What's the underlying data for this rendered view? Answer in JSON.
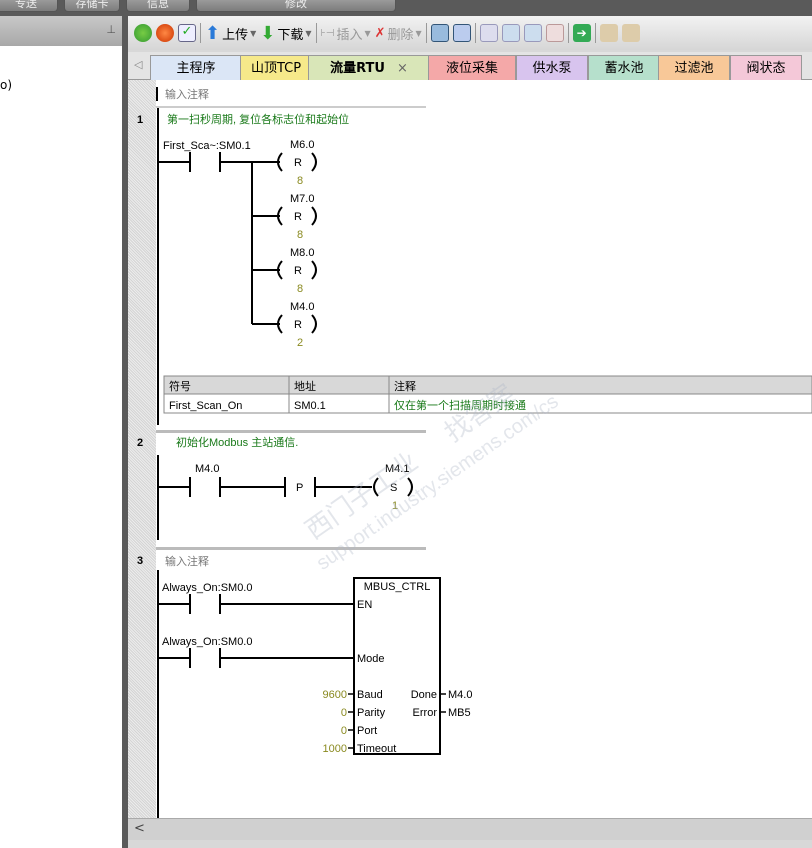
{
  "top_tabs": [
    "专送",
    "存储卡",
    "信息",
    "修改"
  ],
  "left_panel": {
    "pin_icon": "pin-icon",
    "text": "o)"
  },
  "toolbar": {
    "upload": "上传",
    "download": "下载",
    "insert": "插入",
    "delete": "删除"
  },
  "tabs": [
    {
      "label": "主程序",
      "color": "#dbe6f6"
    },
    {
      "label": "山顶TCP",
      "color": "#f6e98a"
    },
    {
      "label": "流量RTU",
      "color": "#d9e6b8",
      "active": true
    },
    {
      "label": "液位采集",
      "color": "#f4a8a8"
    },
    {
      "label": "供水泵",
      "color": "#d8c4ee"
    },
    {
      "label": "蓄水池",
      "color": "#b6e0cc"
    },
    {
      "label": "过滤池",
      "color": "#f8c898"
    },
    {
      "label": "阀状态",
      "color": "#f4c8d8"
    }
  ],
  "tab_close": "×",
  "editor": {
    "header_comment": "输入注释",
    "network1": {
      "number": "1",
      "comment": "第一扫秒周期, 复位各标志位和起始位",
      "contact": "First_Sca~:SM0.1",
      "coils": [
        {
          "addr": "M6.0",
          "op": "R",
          "n": "8"
        },
        {
          "addr": "M7.0",
          "op": "R",
          "n": "8"
        },
        {
          "addr": "M8.0",
          "op": "R",
          "n": "8"
        },
        {
          "addr": "M4.0",
          "op": "R",
          "n": "2"
        }
      ],
      "table": {
        "headers": [
          "符号",
          "地址",
          "注释"
        ],
        "row": [
          "First_Scan_On",
          "SM0.1",
          "仅在第一个扫描周期时接通"
        ]
      }
    },
    "network2": {
      "number": "2",
      "comment": "初始化Modbus 主站通信.",
      "contact": "M4.0",
      "edge": "P",
      "coil": {
        "addr": "M4.1",
        "op": "S",
        "n": "1"
      }
    },
    "network3": {
      "number": "3",
      "comment": "输入注释",
      "contact1": "Always_On:SM0.0",
      "contact2": "Always_On:SM0.0",
      "block": {
        "title": "MBUS_CTRL",
        "en": "EN",
        "mode": "Mode",
        "inputs": [
          {
            "pin": "Baud",
            "val": "9600"
          },
          {
            "pin": "Parity",
            "val": "0"
          },
          {
            "pin": "Port",
            "val": "0"
          },
          {
            "pin": "Timeout",
            "val": "1000"
          }
        ],
        "outputs": [
          {
            "pin": "Done",
            "val": "M4.0"
          },
          {
            "pin": "Error",
            "val": "MB5"
          }
        ]
      }
    }
  },
  "watermark": "西门子工业 找答案 support.industry.siemens.com/cs",
  "colors": {
    "comment": "#1a7a1a",
    "constant": "#8a8a20"
  }
}
